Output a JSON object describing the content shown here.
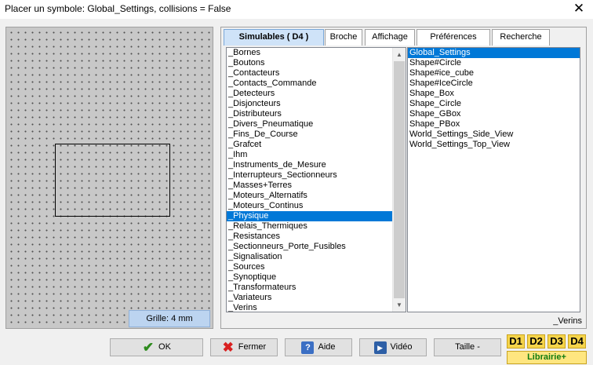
{
  "window": {
    "title": "Placer un symbole:  Global_Settings, collisions = False",
    "close_glyph": "✕"
  },
  "canvas": {
    "grid_label": "Grille: 4 mm"
  },
  "tabs": [
    {
      "label": "Simulables ( D4 )",
      "active": true
    },
    {
      "label": "Broche",
      "active": false
    },
    {
      "label": "Affichage",
      "active": false
    },
    {
      "label": "Préférences",
      "active": false
    },
    {
      "label": "Recherche",
      "active": false
    }
  ],
  "categories": {
    "selected": "_Physique",
    "items": [
      "_Bornes",
      "_Boutons",
      "_Contacteurs",
      "_Contacts_Commande",
      "_Detecteurs",
      "_Disjoncteurs",
      "_Distributeurs",
      "_Divers_Pneumatique",
      "_Fins_De_Course",
      "_Grafcet",
      "_Ihm",
      "_Instruments_de_Mesure",
      "_Interrupteurs_Sectionneurs",
      "_Masses+Terres",
      "_Moteurs_Alternatifs",
      "_Moteurs_Continus",
      "_Physique",
      "_Relais_Thermiques",
      "_Resistances",
      "_Sectionneurs_Porte_Fusibles",
      "_Signalisation",
      "_Sources",
      "_Synoptique",
      "_Transformateurs",
      "_Variateurs",
      "_Verins"
    ]
  },
  "symbols": {
    "selected": "Global_Settings",
    "items": [
      "Global_Settings",
      "Shape#Circle",
      "Shape#ice_cube",
      "Shape#IceCircle",
      "Shape_Box",
      "Shape_Circle",
      "Shape_GBox",
      "Shape_PBox",
      "World_Settings_Side_View",
      "World_Settings_Top_View"
    ]
  },
  "library_footer": "_Verins",
  "buttons": {
    "ok": {
      "label": "OK",
      "icon": "check-icon"
    },
    "close": {
      "label": "Fermer",
      "icon": "red-x-icon"
    },
    "help": {
      "label": "Aide",
      "icon": "help-icon"
    },
    "video": {
      "label": "Vidéo",
      "icon": "film-icon"
    },
    "size": {
      "label": "Taille -"
    }
  },
  "libraries": [
    "D1",
    "D2",
    "D3",
    "D4"
  ],
  "library_plus": "Librairie+",
  "colors": {
    "accent": "#0078d7",
    "library_yellow": "#f5d44a",
    "library_green": "#107c10"
  }
}
